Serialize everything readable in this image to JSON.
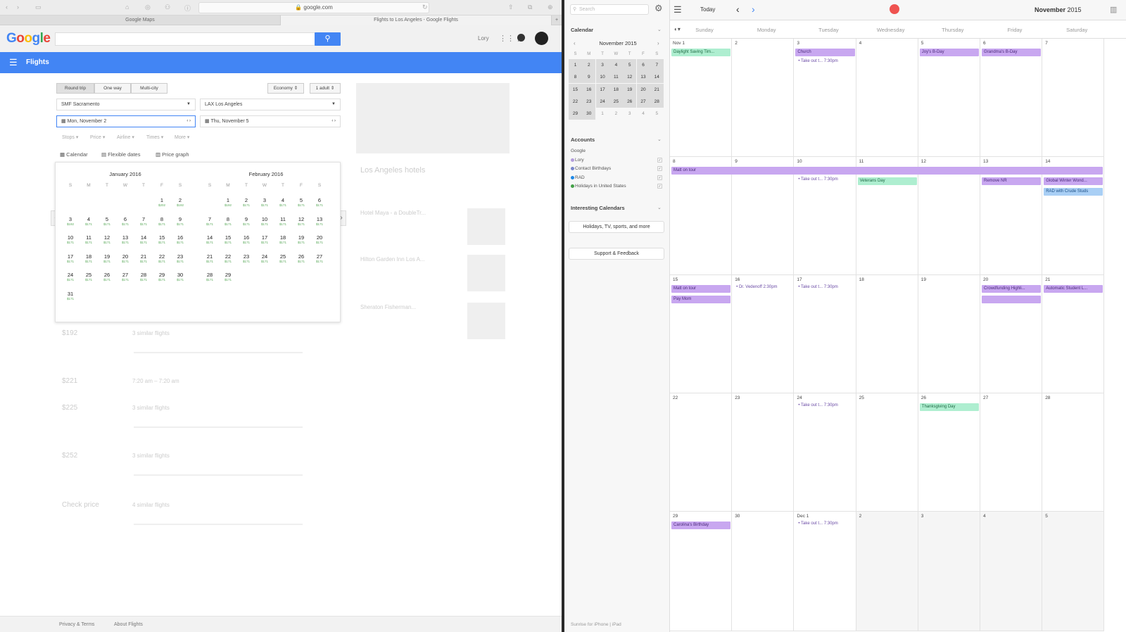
{
  "browser": {
    "address": "google.com",
    "tabs": [
      "Google Maps",
      "Flights to Los Angeles - Google Flights"
    ]
  },
  "google": {
    "logo": "Google",
    "user": "Lory",
    "bar_title": "Flights",
    "trip_types": [
      "Round trip",
      "One way",
      "Multi-city"
    ],
    "cabin": "Economy",
    "passengers": "1 adult",
    "origin": "SMF Sacramento",
    "destination": "LAX Los Angeles",
    "depart": "Mon, November 2",
    "return": "Thu, November 5",
    "filters": [
      "Stops",
      "Price",
      "Airline",
      "Times",
      "More"
    ],
    "views": [
      "Calendar",
      "Flexible dates",
      "Price graph"
    ],
    "months": [
      {
        "title": "January 2016",
        "dows": [
          "S",
          "M",
          "T",
          "W",
          "T",
          "F",
          "S"
        ],
        "rows": [
          [
            null,
            null,
            null,
            null,
            null,
            {
              "d": "1",
              "p": "$202"
            },
            {
              "d": "2",
              "p": "$192"
            }
          ],
          [
            {
              "d": "3",
              "p": "$192"
            },
            {
              "d": "4",
              "p": "$171"
            },
            {
              "d": "5",
              "p": "$171"
            },
            {
              "d": "6",
              "p": "$171"
            },
            {
              "d": "7",
              "p": "$171"
            },
            {
              "d": "8",
              "p": "$171"
            },
            {
              "d": "9",
              "p": "$171"
            }
          ],
          [
            {
              "d": "10",
              "p": "$171"
            },
            {
              "d": "11",
              "p": "$171"
            },
            {
              "d": "12",
              "p": "$171"
            },
            {
              "d": "13",
              "p": "$171"
            },
            {
              "d": "14",
              "p": "$171"
            },
            {
              "d": "15",
              "p": "$171"
            },
            {
              "d": "16",
              "p": "$171"
            }
          ],
          [
            {
              "d": "17",
              "p": "$171"
            },
            {
              "d": "18",
              "p": "$171"
            },
            {
              "d": "19",
              "p": "$171"
            },
            {
              "d": "20",
              "p": "$171"
            },
            {
              "d": "21",
              "p": "$171"
            },
            {
              "d": "22",
              "p": "$171"
            },
            {
              "d": "23",
              "p": "$171"
            }
          ],
          [
            {
              "d": "24",
              "p": "$171"
            },
            {
              "d": "25",
              "p": "$171"
            },
            {
              "d": "26",
              "p": "$171"
            },
            {
              "d": "27",
              "p": "$171"
            },
            {
              "d": "28",
              "p": "$171"
            },
            {
              "d": "29",
              "p": "$171"
            },
            {
              "d": "30",
              "p": "$171"
            }
          ],
          [
            {
              "d": "31",
              "p": "$171"
            },
            null,
            null,
            null,
            null,
            null,
            null
          ]
        ]
      },
      {
        "title": "February 2016",
        "dows": [
          "S",
          "M",
          "T",
          "W",
          "T",
          "F",
          "S"
        ],
        "rows": [
          [
            null,
            {
              "d": "1",
              "p": "$192"
            },
            {
              "d": "2",
              "p": "$171"
            },
            {
              "d": "3",
              "p": "$171"
            },
            {
              "d": "4",
              "p": "$171"
            },
            {
              "d": "5",
              "p": "$171"
            },
            {
              "d": "6",
              "p": "$171"
            }
          ],
          [
            {
              "d": "7",
              "p": "$171"
            },
            {
              "d": "8",
              "p": "$171"
            },
            {
              "d": "9",
              "p": "$171"
            },
            {
              "d": "10",
              "p": "$171"
            },
            {
              "d": "11",
              "p": "$171"
            },
            {
              "d": "12",
              "p": "$171"
            },
            {
              "d": "13",
              "p": "$171"
            }
          ],
          [
            {
              "d": "14",
              "p": "$171"
            },
            {
              "d": "15",
              "p": "$171"
            },
            {
              "d": "16",
              "p": "$171"
            },
            {
              "d": "17",
              "p": "$171"
            },
            {
              "d": "18",
              "p": "$171"
            },
            {
              "d": "19",
              "p": "$171"
            },
            {
              "d": "20",
              "p": "$171"
            }
          ],
          [
            {
              "d": "21",
              "p": "$171"
            },
            {
              "d": "22",
              "p": "$171"
            },
            {
              "d": "23",
              "p": "$171"
            },
            {
              "d": "24",
              "p": "$171"
            },
            {
              "d": "25",
              "p": "$171"
            },
            {
              "d": "26",
              "p": "$171"
            },
            {
              "d": "27",
              "p": "$171"
            }
          ],
          [
            {
              "d": "28",
              "p": "$171"
            },
            {
              "d": "29",
              "p": "$171"
            },
            null,
            null,
            null,
            null,
            null
          ]
        ]
      }
    ],
    "bg_results": [
      {
        "price": "$192",
        "desc": "3 similar flights"
      },
      {
        "price": "$221",
        "desc": "7:20 am – 7:20 am"
      },
      {
        "price": "$225",
        "desc": "3 similar flights"
      },
      {
        "price": "$252",
        "desc": "3 similar flights"
      },
      {
        "price": "Check price",
        "desc": "4 similar flights"
      }
    ],
    "bg_hotels": {
      "title": "Los Angeles hotels",
      "items": [
        "Hotel Maya - a DoubleTr...",
        "Hilton Garden Inn Los A...",
        "Sheraton Fisherman..."
      ]
    },
    "footer": [
      "Privacy & Terms",
      "About Flights"
    ]
  },
  "calendar": {
    "search_placeholder": "Search",
    "section_calendar": "Calendar",
    "mini_month": "November 2015",
    "mini_dows": [
      "S",
      "M",
      "T",
      "W",
      "T",
      "F",
      "S"
    ],
    "mini_rows": [
      [
        "1",
        "2",
        "3",
        "4",
        "5",
        "6",
        "7"
      ],
      [
        "8",
        "9",
        "10",
        "11",
        "12",
        "13",
        "14"
      ],
      [
        "15",
        "16",
        "17",
        "18",
        "19",
        "20",
        "21"
      ],
      [
        "22",
        "23",
        "24",
        "25",
        "26",
        "27",
        "28"
      ],
      [
        "29",
        "30",
        "1",
        "2",
        "3",
        "4",
        "5"
      ]
    ],
    "accounts_title": "Accounts",
    "account_group": "Google",
    "accounts": [
      {
        "name": "Lory",
        "color": "#b39ddb"
      },
      {
        "name": "Contact Birthdays",
        "color": "#7986cb"
      },
      {
        "name": "RAD",
        "color": "#1e88e5"
      },
      {
        "name": "Holidays in United States",
        "color": "#43a047"
      }
    ],
    "interesting_title": "Interesting Calendars",
    "holidays_btn": "Holidays, TV, sports, and more",
    "support_btn": "Support & Feedback",
    "sidebar_footer": "Sunrise for iPhone | iPad",
    "today": "Today",
    "month_title_bold": "November",
    "month_title_year": "2015",
    "weekdays": [
      "Sunday",
      "Monday",
      "Tuesday",
      "Wednesday",
      "Thursday",
      "Friday",
      "Saturday"
    ],
    "weeks": [
      [
        "Nov 1",
        "2",
        "3",
        "4",
        "5",
        "6",
        "7"
      ],
      [
        "8",
        "9",
        "10",
        "11",
        "12",
        "13",
        "14"
      ],
      [
        "15",
        "16",
        "17",
        "18",
        "19",
        "20",
        "21"
      ],
      [
        "22",
        "23",
        "24",
        "25",
        "26",
        "27",
        "28"
      ],
      [
        "29",
        "30",
        "Dec 1",
        "2",
        "3",
        "4",
        "5"
      ]
    ],
    "events": {
      "dst": "Daylight Saving Tim...",
      "church": "Church",
      "takeout": "Take out t... 7:30pm",
      "joy": "Joy's B-Day",
      "grandma": "Grandma's B-Day",
      "matt_tour": "Matt on tour",
      "veterans": "Veterans Day",
      "remove_nr": "Remove NR",
      "global_winter": "Global Winter Wond...",
      "rad_crude": "RAD with Crude Studs",
      "pay_mom": "Pay Mom",
      "dr_vedenoff": "Dr. Vedenoff 2:30pm",
      "crowdfunding": "Crowdfunding Highli...",
      "automatic": "Automatic Student L...",
      "thanksgiving": "Thanksgiving Day",
      "carolina": "Carolina's Birthday"
    }
  }
}
